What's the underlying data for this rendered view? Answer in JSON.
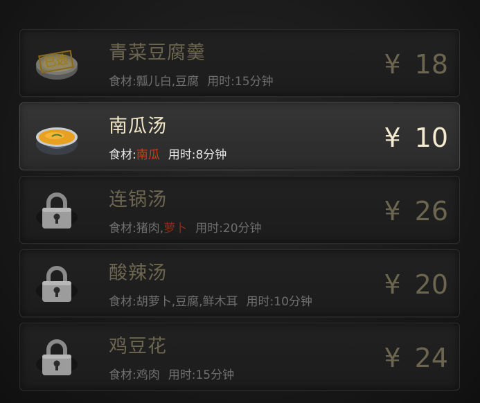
{
  "labels": {
    "ingredients_prefix": "食材:",
    "time_prefix": "用时:",
    "currency": "¥",
    "selected_stamp": "已选"
  },
  "dishes": [
    {
      "name": "青菜豆腐羹",
      "ingredients": [
        {
          "text": "瓢儿白,豆腐",
          "highlight": false
        }
      ],
      "time": "15分钟",
      "price": "18",
      "state": "chosen",
      "icon": "soup-bowl-icon"
    },
    {
      "name": "南瓜汤",
      "ingredients": [
        {
          "text": "南瓜",
          "highlight": true
        }
      ],
      "time": "8分钟",
      "price": "10",
      "state": "selected",
      "icon": "pumpkin-soup-icon"
    },
    {
      "name": "连锅汤",
      "ingredients": [
        {
          "text": "猪肉,",
          "highlight": false
        },
        {
          "text": "萝卜",
          "highlight": true
        }
      ],
      "time": "20分钟",
      "price": "26",
      "state": "locked",
      "icon": "padlock-icon"
    },
    {
      "name": "酸辣汤",
      "ingredients": [
        {
          "text": "胡萝卜,豆腐,鲜木耳",
          "highlight": false
        }
      ],
      "time": "10分钟",
      "price": "20",
      "state": "locked",
      "icon": "padlock-icon"
    },
    {
      "name": "鸡豆花",
      "ingredients": [
        {
          "text": "鸡肉",
          "highlight": false
        }
      ],
      "time": "15分钟",
      "price": "24",
      "state": "locked",
      "icon": "padlock-icon"
    }
  ],
  "colors": {
    "text_dim": "#6c6650",
    "text_bright": "#f0e6c8",
    "highlight_ingredient": "#d03c1f",
    "stamp": "#9a7c22"
  }
}
